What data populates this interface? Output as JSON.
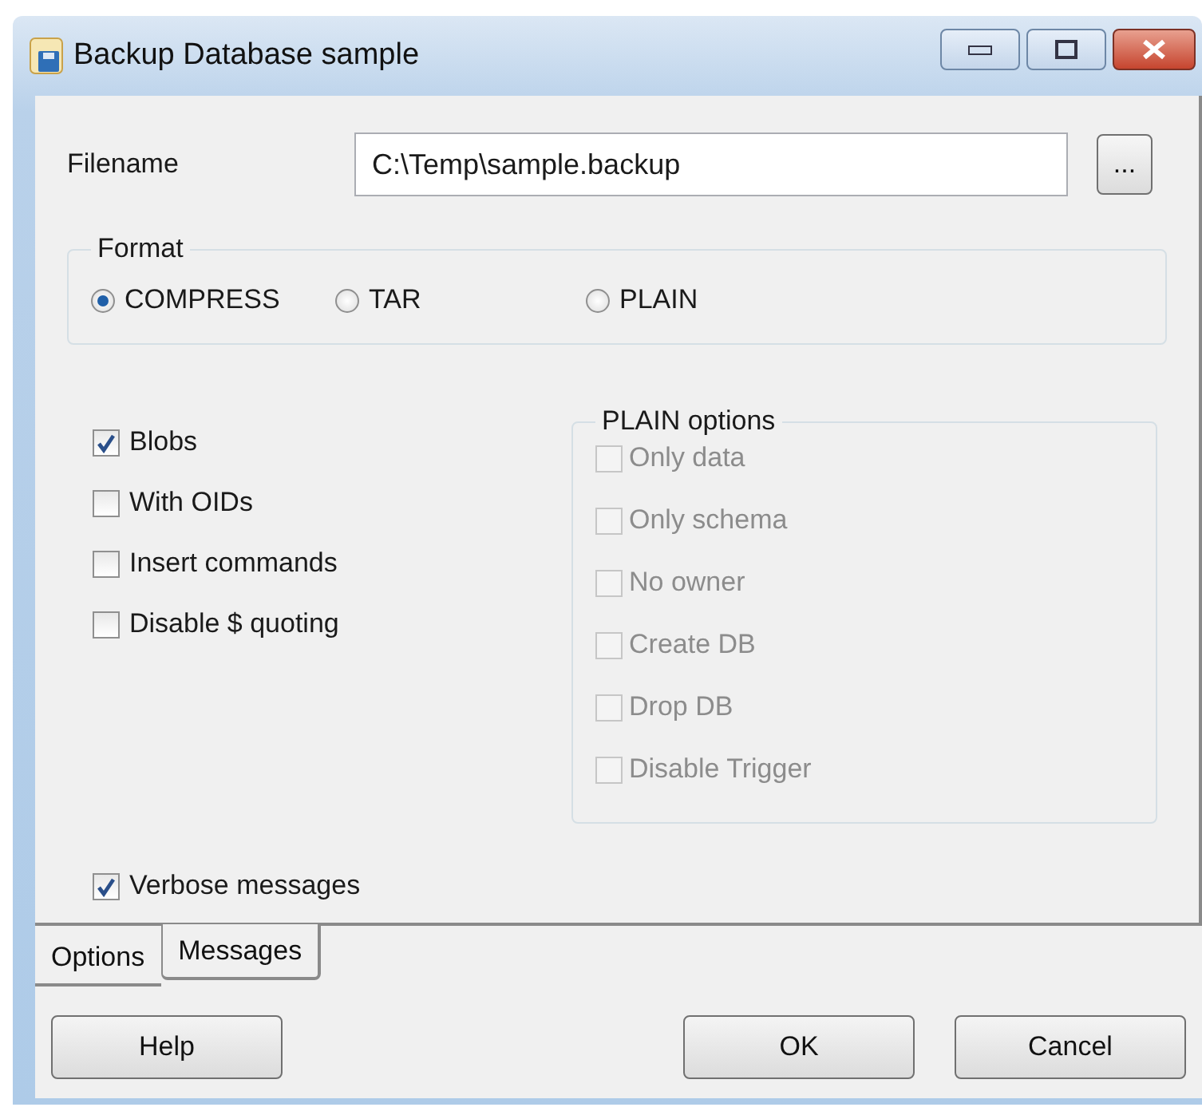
{
  "window": {
    "title": "Backup Database sample"
  },
  "filename": {
    "label": "Filename",
    "value": "C:\\Temp\\sample.backup",
    "browse_button": "..."
  },
  "format": {
    "title": "Format",
    "options": [
      {
        "label": "COMPRESS",
        "selected": true
      },
      {
        "label": "TAR",
        "selected": false
      },
      {
        "label": "PLAIN",
        "selected": false
      }
    ]
  },
  "options": [
    {
      "label": "Blobs",
      "checked": true
    },
    {
      "label": "With OIDs",
      "checked": false
    },
    {
      "label": "Insert commands",
      "checked": false
    },
    {
      "label": "Disable $ quoting",
      "checked": false
    }
  ],
  "plain_options": {
    "title": "PLAIN options",
    "disabled": true,
    "options": [
      {
        "label": "Only data",
        "checked": false
      },
      {
        "label": "Only schema",
        "checked": false
      },
      {
        "label": "No owner",
        "checked": false
      },
      {
        "label": "Create DB",
        "checked": false
      },
      {
        "label": "Drop DB",
        "checked": false
      },
      {
        "label": "Disable Trigger",
        "checked": false
      }
    ]
  },
  "verbose": {
    "label": "Verbose messages",
    "checked": true
  },
  "tabs": [
    {
      "label": "Options",
      "selected": true
    },
    {
      "label": "Messages",
      "selected": false
    }
  ],
  "buttons": [
    {
      "label": "Help",
      "kind": "left"
    },
    {
      "label": "OK",
      "kind": "right"
    },
    {
      "label": "Cancel",
      "kind": "right"
    }
  ]
}
